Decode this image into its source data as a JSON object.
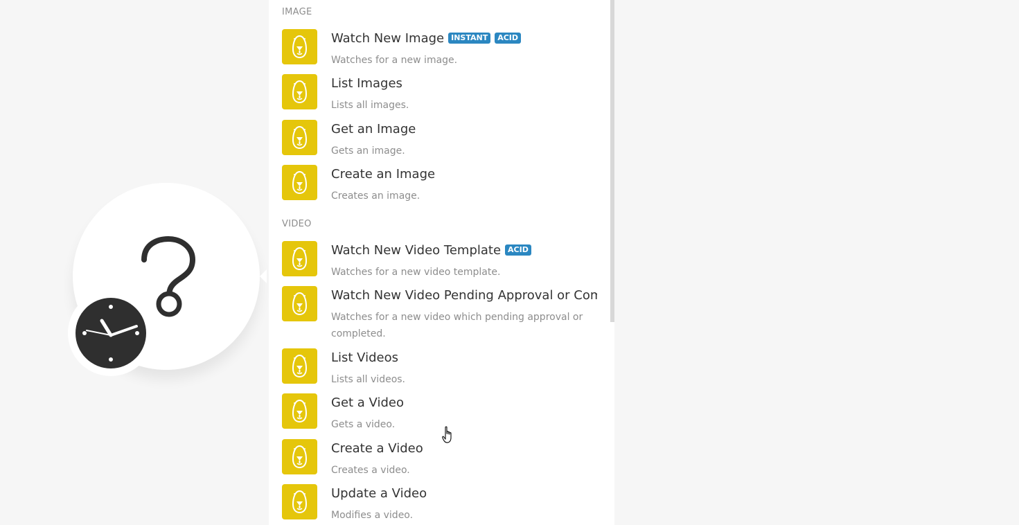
{
  "colors": {
    "module_icon_bg": "#e5c60b",
    "badge_bg": "#2b87c1",
    "background": "#f6f6f6",
    "clock": "#2f2f2f"
  },
  "left_module": {
    "icon_names": [
      "question-mark-icon",
      "clock-icon"
    ]
  },
  "sections": [
    {
      "header": "IMAGE",
      "items": [
        {
          "title": "Watch New Image",
          "badges": [
            "INSTANT",
            "ACID"
          ],
          "description": "Watches for a new image."
        },
        {
          "title": "List Images",
          "badges": [],
          "description": "Lists all images."
        },
        {
          "title": "Get an Image",
          "badges": [],
          "description": "Gets an image."
        },
        {
          "title": "Create an Image",
          "badges": [],
          "description": "Creates an image."
        }
      ]
    },
    {
      "header": "VIDEO",
      "items": [
        {
          "title": "Watch New Video Template",
          "badges": [
            "ACID"
          ],
          "description": "Watches for a new video template."
        },
        {
          "title": "Watch New Video Pending Approval or Completed",
          "badges": [],
          "description": "Watches for a new video which pending approval or completed."
        },
        {
          "title": "List Videos",
          "badges": [],
          "description": "Lists all videos."
        },
        {
          "title": "Get a Video",
          "badges": [],
          "description": "Gets a video."
        },
        {
          "title": "Create a Video",
          "badges": [],
          "description": "Creates a video."
        },
        {
          "title": "Update a Video",
          "badges": [],
          "description": "Modifies a video."
        }
      ]
    }
  ]
}
